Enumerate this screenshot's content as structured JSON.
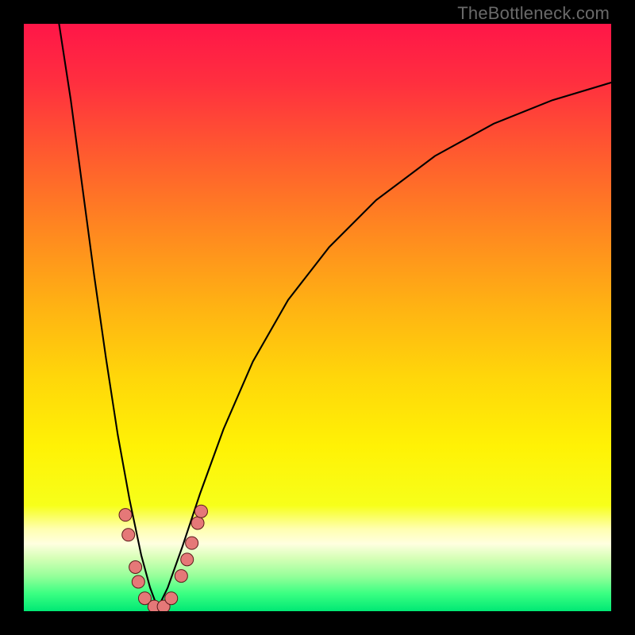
{
  "watermark": "TheBottleneck.com",
  "gradient": {
    "stops": [
      {
        "offset": 0.0,
        "color": "#ff1648"
      },
      {
        "offset": 0.1,
        "color": "#ff2f3f"
      },
      {
        "offset": 0.22,
        "color": "#ff5a2f"
      },
      {
        "offset": 0.35,
        "color": "#ff8720"
      },
      {
        "offset": 0.48,
        "color": "#ffb213"
      },
      {
        "offset": 0.6,
        "color": "#ffd60a"
      },
      {
        "offset": 0.72,
        "color": "#fff205"
      },
      {
        "offset": 0.82,
        "color": "#f7ff1a"
      },
      {
        "offset": 0.86,
        "color": "#ffffb0"
      },
      {
        "offset": 0.885,
        "color": "#ffffe0"
      },
      {
        "offset": 0.91,
        "color": "#d5ffb6"
      },
      {
        "offset": 0.94,
        "color": "#96ff9a"
      },
      {
        "offset": 0.97,
        "color": "#3bff82"
      },
      {
        "offset": 1.0,
        "color": "#00e874"
      }
    ]
  },
  "curve_style": {
    "stroke": "#000000",
    "stroke_width_main": 2.1,
    "marker_fill": "#e57878",
    "marker_stroke": "#5a1a1a",
    "marker_radius": 8
  },
  "markers": [
    {
      "x": 0.173,
      "y": 0.836
    },
    {
      "x": 0.178,
      "y": 0.87
    },
    {
      "x": 0.19,
      "y": 0.925
    },
    {
      "x": 0.195,
      "y": 0.95
    },
    {
      "x": 0.206,
      "y": 0.978
    },
    {
      "x": 0.222,
      "y": 0.992
    },
    {
      "x": 0.238,
      "y": 0.992
    },
    {
      "x": 0.251,
      "y": 0.978
    },
    {
      "x": 0.268,
      "y": 0.94
    },
    {
      "x": 0.278,
      "y": 0.912
    },
    {
      "x": 0.286,
      "y": 0.884
    },
    {
      "x": 0.296,
      "y": 0.85
    },
    {
      "x": 0.302,
      "y": 0.83
    }
  ],
  "chart_data": {
    "type": "line",
    "title": "",
    "xlabel": "",
    "ylabel": "",
    "xlim": [
      0,
      1
    ],
    "ylim": [
      0,
      1
    ],
    "note": "V-shaped bottleneck curve on a vertical performance heat gradient (red=high bottleneck at top, green=low at bottom). Minimum near x≈0.23.",
    "series": [
      {
        "name": "bottleneck-curve-left",
        "x": [
          0.06,
          0.08,
          0.1,
          0.12,
          0.14,
          0.16,
          0.18,
          0.2,
          0.215,
          0.228
        ],
        "y": [
          0.0,
          0.13,
          0.28,
          0.43,
          0.57,
          0.7,
          0.81,
          0.905,
          0.96,
          0.995
        ]
      },
      {
        "name": "bottleneck-curve-right",
        "x": [
          0.228,
          0.245,
          0.27,
          0.3,
          0.34,
          0.39,
          0.45,
          0.52,
          0.6,
          0.7,
          0.8,
          0.9,
          1.0
        ],
        "y": [
          0.995,
          0.96,
          0.89,
          0.8,
          0.69,
          0.575,
          0.47,
          0.38,
          0.3,
          0.225,
          0.17,
          0.13,
          0.1
        ]
      },
      {
        "name": "highlighted-points",
        "x": [
          0.173,
          0.178,
          0.19,
          0.195,
          0.206,
          0.222,
          0.238,
          0.251,
          0.268,
          0.278,
          0.286,
          0.296,
          0.302
        ],
        "y": [
          0.836,
          0.87,
          0.925,
          0.95,
          0.978,
          0.992,
          0.992,
          0.978,
          0.94,
          0.912,
          0.884,
          0.85,
          0.83
        ]
      }
    ]
  }
}
